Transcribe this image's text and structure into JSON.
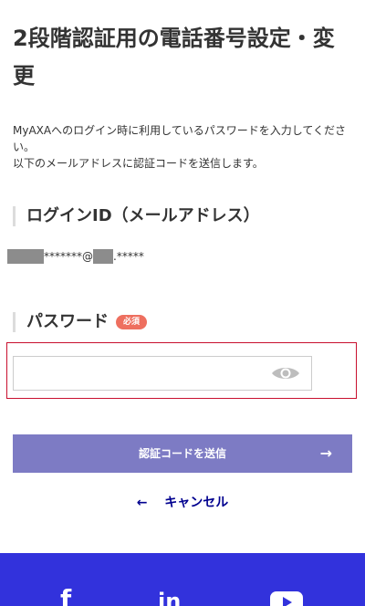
{
  "page": {
    "title": "2段階認証用の電話番号設定・変更",
    "description_line1": "MyAXAへのログイン時に利用しているパスワードを入力してください。",
    "description_line2": "以下のメールアドレスに認証コードを送信します。"
  },
  "login_id": {
    "heading": "ログインID（メールアドレス）",
    "masked_local": "*******@",
    "masked_domain": ".*****"
  },
  "password": {
    "heading": "パスワード",
    "required_badge": "必須",
    "value": "",
    "placeholder": "",
    "visibility_icon": "eye-icon"
  },
  "actions": {
    "submit_label": "認証コードを送信",
    "submit_arrow": "→",
    "cancel_label": "キャンセル",
    "cancel_arrow": "←"
  },
  "footer": {
    "facebook_glyph": "f",
    "linkedin_glyph": "in",
    "youtube_icon": "youtube-icon"
  },
  "colors": {
    "primary_button": "#7d7bc4",
    "link": "#00008f",
    "required_badge": "#ee6f5f",
    "error_border": "#c8102e",
    "footer": "#3232dc"
  }
}
